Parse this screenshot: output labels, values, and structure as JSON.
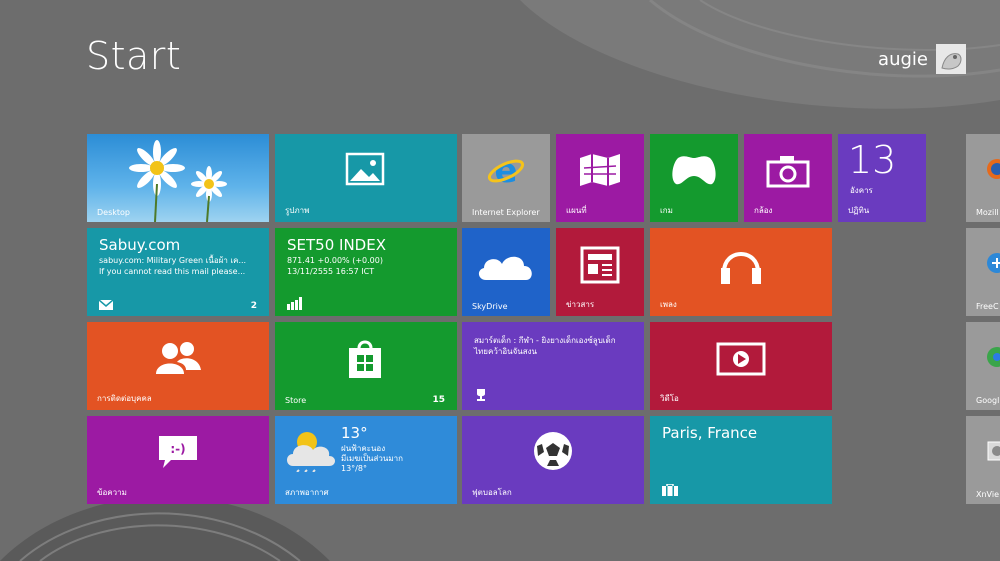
{
  "header": {
    "title": "Start",
    "user_name": "augie"
  },
  "tiles": {
    "desktop": {
      "label": "Desktop"
    },
    "photos": {
      "label": "รูปภาพ"
    },
    "ie": {
      "label": "Internet Explorer"
    },
    "maps": {
      "label": "แผนที่"
    },
    "games": {
      "label": "เกม"
    },
    "camera": {
      "label": "กล้อง"
    },
    "calendar": {
      "label": "ปฏิทิน",
      "day": "13",
      "weekday": "อังคาร"
    },
    "mail": {
      "sender": "Sabuy.com",
      "line1": "sabuy.com: Military Green เนื้อผ้า เค...",
      "line2": "If you cannot read this mail please...",
      "count": "2"
    },
    "finance": {
      "title": "SET50 INDEX",
      "line1": "871.41   +0.00% (+0.00)",
      "line2": "13/11/2555 16:57 ICT"
    },
    "skydrive": {
      "label": "SkyDrive"
    },
    "news": {
      "label": "ข่าวสาร"
    },
    "music": {
      "label": "เพลง"
    },
    "people": {
      "label": "การติดต่อบุคคล"
    },
    "store": {
      "label": "Store",
      "count": "15"
    },
    "sports": {
      "line1": "สมาร์ตเด็ก : กีฬา - ยิงยางเด็กเองซ์ลูบเด็ก",
      "line2": "ไทยคว้าอินจันสงน"
    },
    "video": {
      "label": "วิดีโอ"
    },
    "messaging": {
      "label": "ข้อความ"
    },
    "weather": {
      "label": "สภาพอากาศ",
      "temp": "13°",
      "line1": "ฝนฟ้าคะนอง",
      "line2": "มีเมฆเป็นส่วนมาก",
      "line3": "13°/8°"
    },
    "soccer": {
      "label": "ฟุตบอลโลก"
    },
    "travel": {
      "title": "Paris, France"
    },
    "right_col": [
      {
        "label": "Mozill"
      },
      {
        "label": "FreeC"
      },
      {
        "label": "Googl"
      },
      {
        "label": "XnVie"
      }
    ]
  },
  "colors": {
    "background": "#6d6d6d",
    "teal": "#1798a7",
    "green": "#149a2e",
    "purple_mag": "#9c1aa3",
    "purple": "#6a3bbf",
    "orange": "#e35323",
    "red": "#b21a3b",
    "blue": "#1f63c9",
    "gray": "#9a9a9a"
  }
}
